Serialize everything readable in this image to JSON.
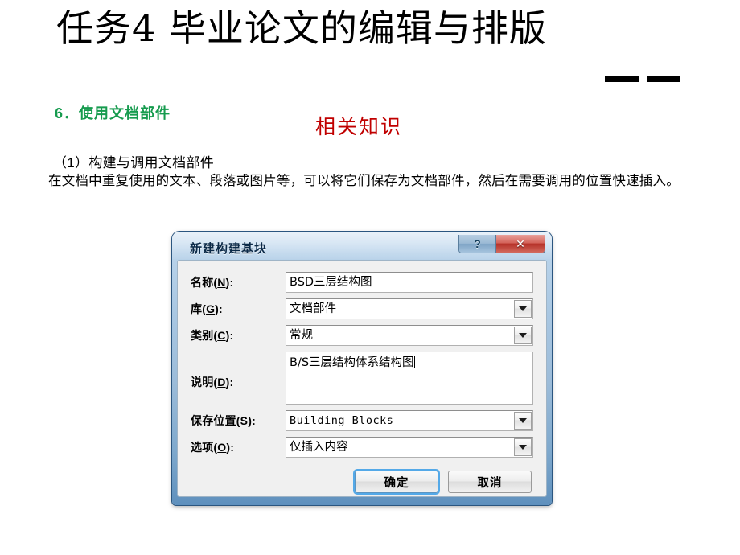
{
  "slide": {
    "title": "任务4  毕业论文的编辑与排版",
    "title_dashes": "— —",
    "section_heading": "6．使用文档部件",
    "knowledge_heading": "相关知识",
    "subsection": "（1）构建与调用文档部件",
    "paragraph": "在文档中重复使用的文本、段落或图片等，可以将它们保存为文档部件，然后在需要调用的位置快速插入。",
    "colors": {
      "background": "#ffffff",
      "section_green": "#169b4e",
      "knowledge_red": "#c00000",
      "body_black": "#000000"
    }
  },
  "dialog": {
    "title": "新建构建基块",
    "caption_buttons": {
      "help": "?",
      "close": "✕"
    },
    "fields": [
      {
        "label": "名称(N):",
        "label_pre": "名称(",
        "mnemonic": "N",
        "label_post": "):",
        "value": "BSD三层结构图",
        "control": "text"
      },
      {
        "label": "库(G):",
        "label_pre": "库(",
        "mnemonic": "G",
        "label_post": "):",
        "value": "文档部件",
        "control": "combo"
      },
      {
        "label": "类别(C):",
        "label_pre": "类别(",
        "mnemonic": "C",
        "label_post": "):",
        "value": "常规",
        "control": "combo"
      },
      {
        "label": "说明(D):",
        "label_pre": "说明(",
        "mnemonic": "D",
        "label_post": "):",
        "value": "B/S三层结构体系结构图",
        "control": "textarea"
      },
      {
        "label": "保存位置(S):",
        "label_pre": "保存位置(",
        "mnemonic": "S",
        "label_post": "):",
        "value": "Building Blocks",
        "control": "combo"
      },
      {
        "label": "选项(O):",
        "label_pre": "选项(",
        "mnemonic": "O",
        "label_post": "):",
        "value": "仅插入内容",
        "control": "combo"
      }
    ],
    "buttons": {
      "ok": "确定",
      "cancel": "取消"
    },
    "colors": {
      "frame_blue": "#9cbcd9",
      "body_gray": "#f0f0f0",
      "close_red": "#b53128",
      "default_focus": "#54a9e8"
    }
  }
}
